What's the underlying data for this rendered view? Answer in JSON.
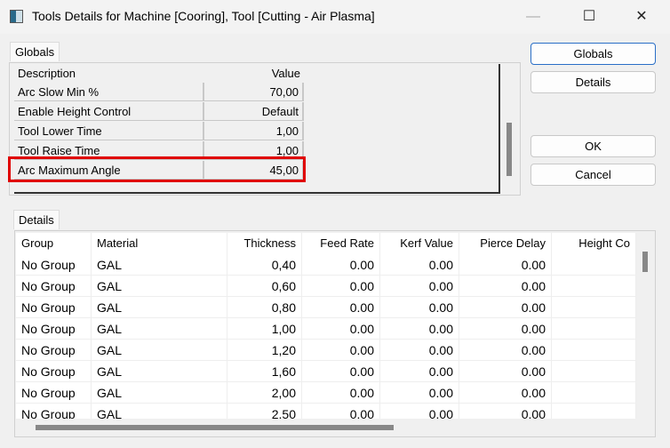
{
  "window": {
    "title": "Tools Details for Machine [Cooring], Tool [Cutting - Air Plasma]",
    "minimize": "—",
    "maximize": "☐",
    "close": "✕"
  },
  "globals": {
    "tab": "Globals",
    "headers": {
      "description": "Description",
      "value": "Value"
    },
    "rows": [
      {
        "description": "Arc Slow Min %",
        "value": "70,00"
      },
      {
        "description": "Enable Height Control",
        "value": "Default"
      },
      {
        "description": "Tool Lower Time",
        "value": "1,00"
      },
      {
        "description": "Tool Raise Time",
        "value": "1,00"
      },
      {
        "description": "Arc Maximum Angle",
        "value": "45,00"
      }
    ]
  },
  "buttons": {
    "globals": "Globals",
    "details": "Details",
    "ok": "OK",
    "cancel": "Cancel"
  },
  "details": {
    "tab": "Details",
    "headers": [
      "Group",
      "Material",
      "Thickness",
      "Feed Rate",
      "Kerf Value",
      "Pierce Delay",
      "Height Co"
    ],
    "rows": [
      [
        "No Group",
        "GAL",
        "0,40",
        "0.00",
        "0.00",
        "0.00",
        ""
      ],
      [
        "No Group",
        "GAL",
        "0,60",
        "0.00",
        "0.00",
        "0.00",
        ""
      ],
      [
        "No Group",
        "GAL",
        "0,80",
        "0.00",
        "0.00",
        "0.00",
        ""
      ],
      [
        "No Group",
        "GAL",
        "1,00",
        "0.00",
        "0.00",
        "0.00",
        ""
      ],
      [
        "No Group",
        "GAL",
        "1,20",
        "0.00",
        "0.00",
        "0.00",
        ""
      ],
      [
        "No Group",
        "GAL",
        "1,60",
        "0.00",
        "0.00",
        "0.00",
        ""
      ],
      [
        "No Group",
        "GAL",
        "2,00",
        "0.00",
        "0.00",
        "0.00",
        ""
      ],
      [
        "No Group",
        "GAL",
        "2,50",
        "0.00",
        "0.00",
        "0.00",
        ""
      ]
    ]
  },
  "colors": {
    "highlight": "#e00000",
    "focus": "#2a6fc7"
  }
}
